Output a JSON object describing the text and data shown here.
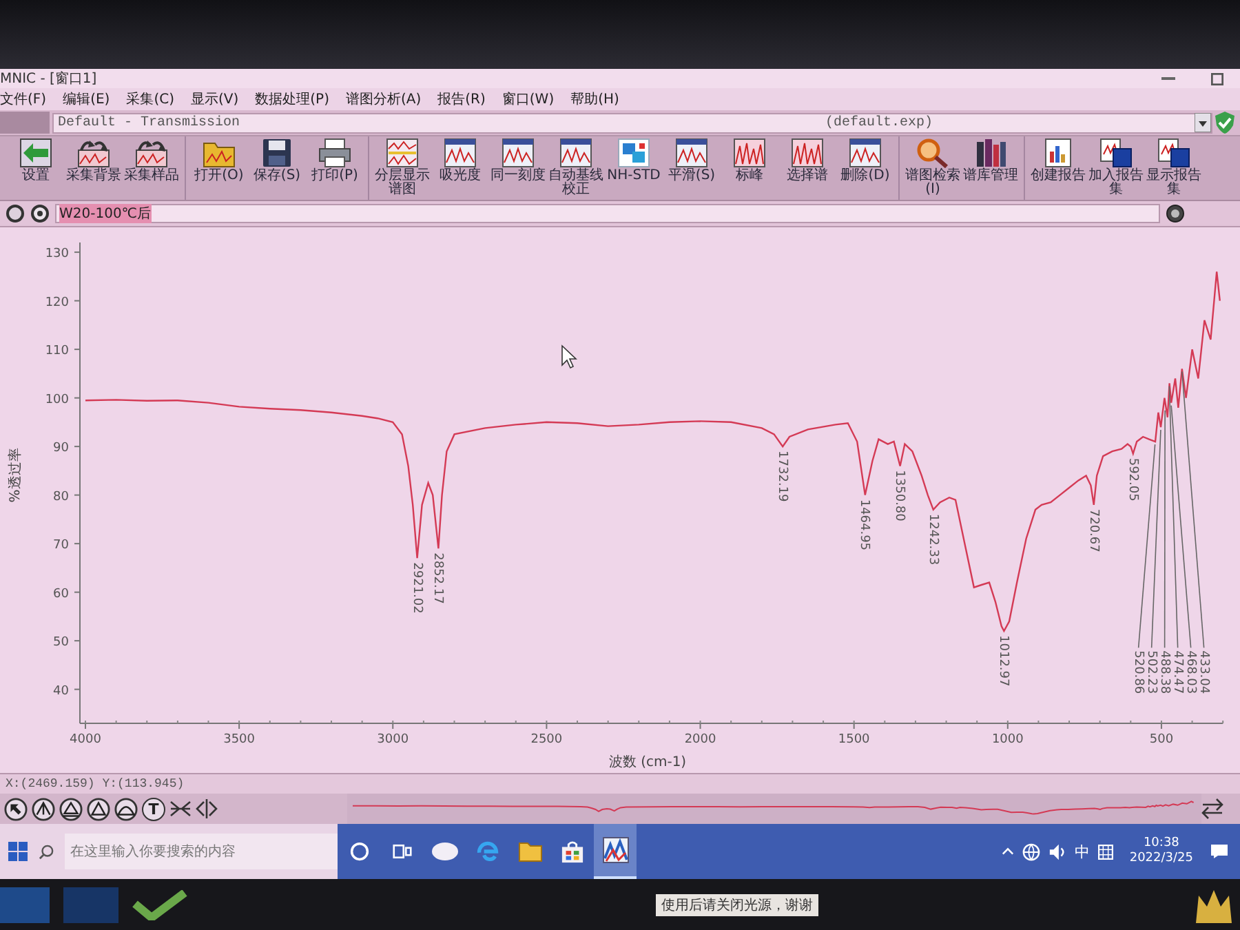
{
  "window": {
    "title": "MNIC - [窗口1]"
  },
  "menu": [
    "文件(F)",
    "编辑(E)",
    "采集(C)",
    "显示(V)",
    "数据处理(P)",
    "谱图分析(A)",
    "报告(R)",
    "窗口(W)",
    "帮助(H)"
  ],
  "experiment": {
    "name": "Default - Transmission",
    "file": "(default.exp)"
  },
  "toolbar": {
    "groups": [
      [
        "设置",
        "采集背景",
        "采集样品"
      ],
      [
        "打开(O)",
        "保存(S)",
        "打印(P)"
      ],
      [
        "分层显示谱图",
        "吸光度",
        "同一刻度",
        "自动基线校正",
        "NH-STD",
        "平滑(S)",
        "标峰",
        "选择谱",
        "删除(D)"
      ],
      [
        "谱图检索(I)",
        "谱库管理"
      ],
      [
        "创建报告",
        "加入报告集",
        "显示报告集"
      ]
    ]
  },
  "spectrum_title": {
    "value": "W20-100℃后",
    "selected": true
  },
  "chart": {
    "chart_data": {
      "type": "line",
      "xlabel": "波数 (cm-1)",
      "ylabel": "%透过率",
      "x": [
        4000,
        3900,
        3800,
        3700,
        3600,
        3500,
        3400,
        3300,
        3200,
        3100,
        3050,
        3000,
        2970,
        2950,
        2935,
        2921,
        2905,
        2885,
        2870,
        2852,
        2840,
        2825,
        2800,
        2700,
        2600,
        2500,
        2400,
        2300,
        2200,
        2100,
        2000,
        1900,
        1800,
        1760,
        1732,
        1710,
        1650,
        1560,
        1520,
        1490,
        1464,
        1440,
        1420,
        1390,
        1370,
        1350,
        1335,
        1310,
        1280,
        1260,
        1242,
        1220,
        1190,
        1170,
        1140,
        1110,
        1085,
        1060,
        1040,
        1020,
        1012,
        995,
        970,
        940,
        910,
        890,
        860,
        830,
        800,
        770,
        745,
        730,
        720,
        710,
        690,
        660,
        630,
        610,
        600,
        592,
        580,
        560,
        540,
        520,
        510,
        502,
        490,
        480,
        474,
        468,
        455,
        445,
        433,
        420,
        400,
        380,
        360,
        340,
        320,
        310
      ],
      "series": [
        {
          "color": "#d43a55",
          "values": [
            99.5,
            99.6,
            99.4,
            99.5,
            99.0,
            98.2,
            97.8,
            97.5,
            97.0,
            96.3,
            95.8,
            95.0,
            92.5,
            86,
            78,
            67,
            78,
            82.5,
            80,
            69,
            80,
            89,
            92.5,
            93.8,
            94.5,
            95,
            94.8,
            94.2,
            94.5,
            95,
            95.2,
            95,
            93.8,
            92.5,
            90,
            92,
            93.5,
            94.5,
            94.8,
            91,
            80,
            87,
            91.5,
            90.5,
            91,
            86,
            90.5,
            89,
            84,
            80,
            77,
            78.5,
            79.5,
            79,
            70,
            61,
            61.5,
            62,
            58,
            53,
            52,
            54,
            62,
            71,
            77,
            78,
            78.5,
            80,
            81.5,
            83,
            84,
            82,
            78,
            84,
            88,
            89,
            89.5,
            90.5,
            90,
            88.5,
            91,
            92,
            91.5,
            91,
            97,
            94,
            100,
            96,
            103,
            99,
            104,
            98,
            106,
            100,
            110,
            104,
            116,
            112,
            126,
            120
          ]
        }
      ],
      "xlim": [
        4000,
        300
      ],
      "ylim": [
        33,
        132
      ],
      "xticks": [
        4000,
        3500,
        3000,
        2500,
        2000,
        1500,
        1000,
        500
      ],
      "yticks": [
        40,
        50,
        60,
        70,
        80,
        90,
        100,
        110,
        120,
        130
      ],
      "annotations": [
        {
          "x": 2921.02,
          "y": 67,
          "text": "2921.02"
        },
        {
          "x": 2852.17,
          "y": 69,
          "text": "2852.17"
        },
        {
          "x": 1732.19,
          "y": 90,
          "text": "1732.19"
        },
        {
          "x": 1464.95,
          "y": 80,
          "text": "1464.95"
        },
        {
          "x": 1350.8,
          "y": 86,
          "text": "1350.80"
        },
        {
          "x": 1242.33,
          "y": 77,
          "text": "1242.33"
        },
        {
          "x": 1012.97,
          "y": 52,
          "text": "1012.97"
        },
        {
          "x": 720.67,
          "y": 78,
          "text": "720.67"
        },
        {
          "x": 592.05,
          "y": 88.5,
          "text": "592.05"
        },
        {
          "x": 520.86,
          "y": 91,
          "text": "520.86"
        },
        {
          "x": 502.23,
          "y": 94,
          "text": "502.23"
        },
        {
          "x": 488.38,
          "y": 98,
          "text": "488.38"
        },
        {
          "x": 474.47,
          "y": 103,
          "text": "474.47"
        },
        {
          "x": 468.03,
          "y": 99,
          "text": "468.03"
        },
        {
          "x": 433.04,
          "y": 106,
          "text": "433.04"
        }
      ]
    }
  },
  "status_bar": "X:(2469.159) Y:(113.945)",
  "tools": {
    "text_tool": "T"
  },
  "taskbar": {
    "search": {
      "placeholder": "在这里输入你要搜索的内容"
    },
    "apps": [
      {
        "selected": false
      },
      {
        "selected": false
      },
      {
        "selected": false
      },
      {
        "selected": false
      },
      {
        "selected": false
      },
      {
        "selected": false
      },
      {
        "selected": true
      }
    ],
    "ime": "中",
    "time": "10:38",
    "date": "2022/3/25"
  },
  "sticker": {
    "text": "使用后请关闭光源，谢谢"
  }
}
